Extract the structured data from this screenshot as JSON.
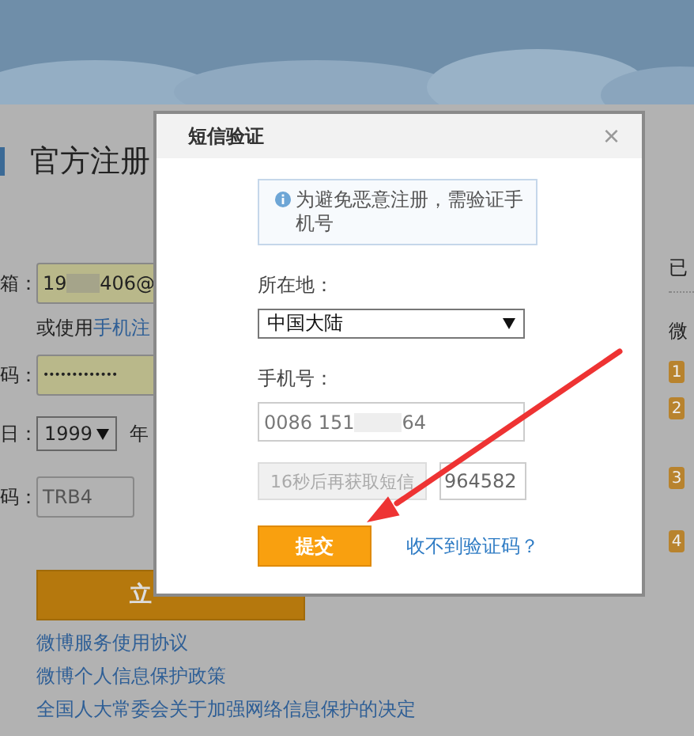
{
  "page": {
    "title": "官方注册",
    "fields": [
      {
        "kind": "input",
        "label": "箱：",
        "value_start": "19",
        "value_end": "406@",
        "highlighted": true
      },
      {
        "kind": "note",
        "text": "或使用",
        "link": "手机注"
      },
      {
        "kind": "password",
        "label": "码：",
        "value": "•••••••••••••",
        "highlighted": true
      },
      {
        "kind": "date",
        "label": "日：",
        "year": "1999",
        "unit": "年"
      },
      {
        "kind": "captcha",
        "label": "码：",
        "placeholder": "TRB4"
      }
    ],
    "submit": "立",
    "links": [
      "微博服务使用协议",
      "微博个人信息保护政策",
      "全国人大常委会关于加强网络信息保护的决定"
    ],
    "side": {
      "heading": "已",
      "subheading": "微",
      "badges": [
        "1",
        "2",
        "3",
        "4"
      ]
    }
  },
  "dialog": {
    "title": "短信验证",
    "close": "×",
    "notice": "为避免恶意注册，需验证手机号",
    "region_label": "所在地：",
    "region": "中国大陆",
    "phone_label": "手机号：",
    "phone_start": "0086 151",
    "phone_end": "64",
    "resend": {
      "label": "16秒后再获取短信",
      "disabled": true
    },
    "code": "964582",
    "submit": "提交",
    "help_link": "收不到验证码？"
  }
}
